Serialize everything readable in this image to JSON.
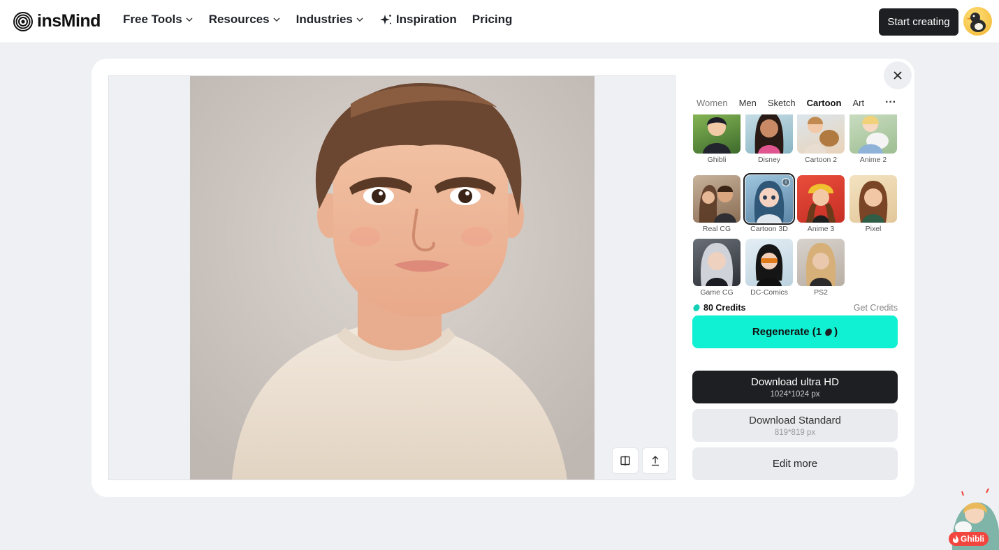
{
  "header": {
    "logo_text": "insMind",
    "nav": [
      {
        "label": "Free Tools",
        "has_dropdown": true
      },
      {
        "label": "Resources",
        "has_dropdown": true
      },
      {
        "label": "Industries",
        "has_dropdown": true
      },
      {
        "label": "Inspiration",
        "has_dropdown": false
      },
      {
        "label": "Pricing",
        "has_dropdown": false
      }
    ],
    "cta_label": "Start creating"
  },
  "panel": {
    "tabs": [
      {
        "label": "Women",
        "active": false
      },
      {
        "label": "Men",
        "active": false
      },
      {
        "label": "Sketch",
        "active": false
      },
      {
        "label": "Cartoon",
        "active": true
      },
      {
        "label": "Art",
        "active": false
      }
    ],
    "more_label": "···",
    "styles": [
      {
        "label": "Ghibli",
        "selected": false
      },
      {
        "label": "Disney",
        "selected": false
      },
      {
        "label": "Cartoon 2",
        "selected": false
      },
      {
        "label": "Anime 2",
        "selected": false
      },
      {
        "label": "Real CG",
        "selected": false
      },
      {
        "label": "Cartoon 3D",
        "selected": true
      },
      {
        "label": "Anime 3",
        "selected": false
      },
      {
        "label": "Pixel",
        "selected": false
      },
      {
        "label": "Game CG",
        "selected": false
      },
      {
        "label": "DC-Comics",
        "selected": false
      },
      {
        "label": "PS2",
        "selected": false
      }
    ],
    "credits_label": "80 Credits",
    "get_credits_label": "Get Credits",
    "regenerate_label": "Regenerate (1",
    "regenerate_suffix": ")",
    "download_hd": {
      "label": "Download ultra HD",
      "size": "1024*1024 px"
    },
    "download_standard": {
      "label": "Download Standard",
      "size": "819*819 px"
    },
    "edit_more_label": "Edit more"
  },
  "widget": {
    "badge_label": "Ghibli"
  },
  "colors": {
    "accent": "#10f0d2",
    "dark": "#1d1f22",
    "badge": "#f2453d"
  }
}
